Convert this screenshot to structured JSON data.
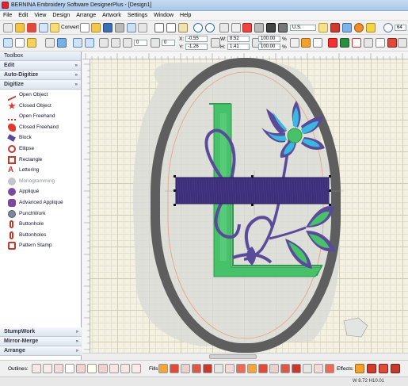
{
  "window": {
    "title": "BERNINA Embroidery Software DesignerPlus - [Design1]"
  },
  "menu": [
    {
      "label": "File",
      "key": "F"
    },
    {
      "label": "Edit",
      "key": "E"
    },
    {
      "label": "View",
      "key": "V"
    },
    {
      "label": "Design",
      "key": "D"
    },
    {
      "label": "Arrange",
      "key": "A"
    },
    {
      "label": "Artwork",
      "key": "k"
    },
    {
      "label": "Settings",
      "key": "S"
    },
    {
      "label": "Window",
      "key": "W"
    },
    {
      "label": "Help",
      "key": "H"
    }
  ],
  "toolbar": {
    "convert_label": "Convert",
    "hoop_select": "U.S.",
    "zoom_value": "64",
    "rotate_value": "0",
    "skew_value": "0",
    "x_label": "X:",
    "x_value": "-0.55",
    "y_label": "Y:",
    "y_value": "-1.26",
    "w_label": "W:",
    "w_value": "8.52",
    "h_label": "H:",
    "h_value": "1.41",
    "w_pct": "100.00",
    "h_pct": "100.00",
    "pct_unit": "%"
  },
  "sidebar": {
    "title": "Toolbox",
    "sections_top": [
      "Edit",
      "Auto-Digitize",
      "Digitize"
    ],
    "tools": [
      {
        "label": "Open Object",
        "icon": "open-object-icon",
        "enabled": true
      },
      {
        "label": "Closed Object",
        "icon": "closed-object-icon",
        "enabled": true
      },
      {
        "label": "Open Freehand",
        "icon": "open-freehand-icon",
        "enabled": true
      },
      {
        "label": "Closed Freehand",
        "icon": "closed-freehand-icon",
        "enabled": true
      },
      {
        "label": "Block",
        "icon": "block-icon",
        "enabled": true
      },
      {
        "label": "Ellipse",
        "icon": "ellipse-icon",
        "enabled": true
      },
      {
        "label": "Rectangle",
        "icon": "rectangle-icon",
        "enabled": true
      },
      {
        "label": "Lettering",
        "icon": "lettering-icon",
        "enabled": true
      },
      {
        "label": "Monogramming",
        "icon": "monogramming-icon",
        "enabled": false
      },
      {
        "label": "Appliqué",
        "icon": "applique-icon",
        "enabled": true
      },
      {
        "label": "Advanced Appliqué",
        "icon": "advanced-applique-icon",
        "enabled": true
      },
      {
        "label": "PunchWork",
        "icon": "punchwork-icon",
        "enabled": true
      },
      {
        "label": "Buttonhole",
        "icon": "buttonhole-icon",
        "enabled": true
      },
      {
        "label": "Buttonholes",
        "icon": "buttonholes-icon",
        "enabled": true
      },
      {
        "label": "Pattern Stamp",
        "icon": "pattern-stamp-icon",
        "enabled": true
      }
    ],
    "sections_bottom": [
      "StumpWork",
      "Mirror-Merge",
      "Arrange"
    ]
  },
  "bottom": {
    "outlines_label": "Outlines:",
    "fills_label": "Fills:",
    "effects_label": "Effects:"
  },
  "status": {
    "text": "W 8.72 H10.01"
  },
  "colors": {
    "accent": "#3a78c8",
    "hoop": "#5f5f5f",
    "letter_green": "#3fbf6a",
    "purple": "#5a4a9a",
    "cyan": "#3ab8e0"
  }
}
